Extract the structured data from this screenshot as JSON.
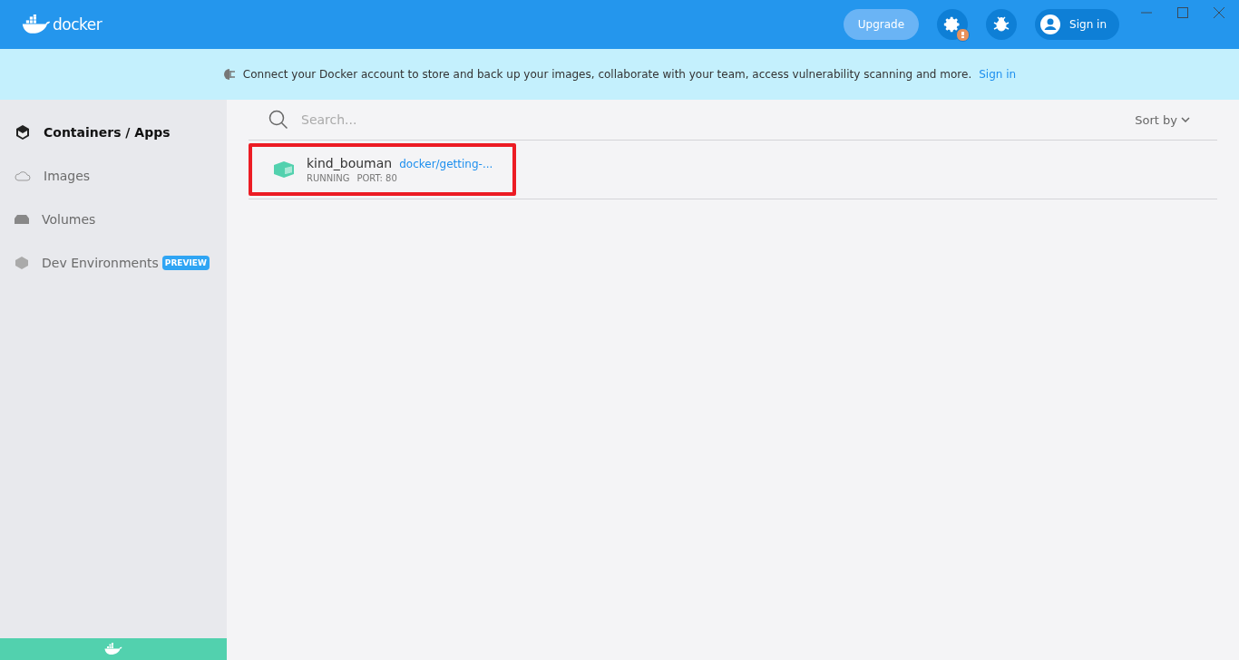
{
  "header": {
    "logo_text": "docker",
    "upgrade": "Upgrade",
    "settings_alert": true,
    "sign_in": "Sign in"
  },
  "banner": {
    "text": "Connect your Docker account to store and back up your images, collaborate with your team, access vulnerability scanning and more.",
    "link": "Sign in"
  },
  "sidebar": {
    "items": [
      {
        "kind": "containers",
        "label": "Containers / Apps",
        "selected": true
      },
      {
        "kind": "images",
        "label": "Images",
        "selected": false
      },
      {
        "kind": "volumes",
        "label": "Volumes",
        "selected": false
      },
      {
        "kind": "dev",
        "label": "Dev Environments",
        "selected": false,
        "badge": "PREVIEW"
      }
    ]
  },
  "search": {
    "placeholder": "Search..."
  },
  "sort": {
    "label": "Sort by"
  },
  "containers": [
    {
      "name": "kind_bouman",
      "image": "docker/getting-...",
      "status": "RUNNING",
      "port": "PORT: 80",
      "highlighted": true
    }
  ]
}
